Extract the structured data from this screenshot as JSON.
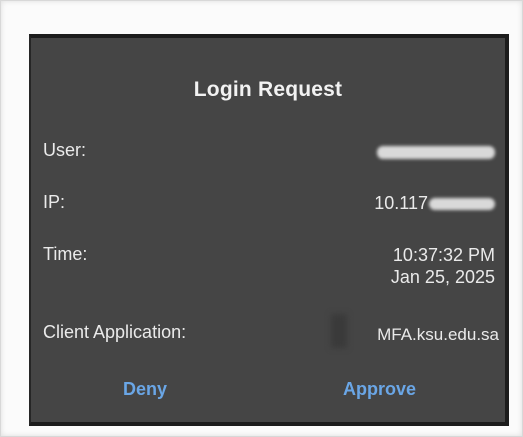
{
  "dialog": {
    "title": "Login Request",
    "rows": [
      {
        "label": "User:",
        "value": ""
      },
      {
        "label": "IP:",
        "value": "10.117"
      },
      {
        "label": "Time:",
        "value_line1": "10:37:32 PM",
        "value_line2": "Jan 25, 2025"
      },
      {
        "label": "Client Application:",
        "value": "MFA.ksu.edu.sa"
      }
    ],
    "buttons": {
      "deny_label": "Deny",
      "approve_label": "Approve"
    }
  },
  "colors": {
    "dialog_bg": "#454545",
    "button_text": "#6aa6e6",
    "text": "#ececec"
  }
}
